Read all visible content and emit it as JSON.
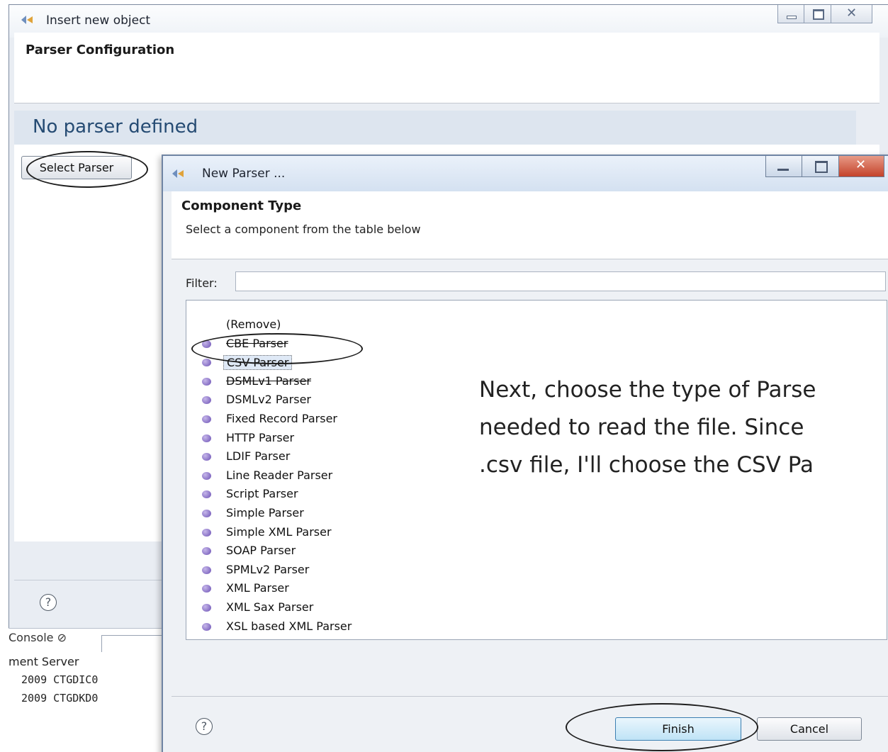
{
  "outer_window": {
    "title": "Insert new object",
    "header_title": "Parser Configuration",
    "status_message": "No parser defined",
    "select_parser_label": "Select Parser",
    "help_symbol": "?"
  },
  "console": {
    "tab_label": "Console ⊘",
    "server_line": "ment Server",
    "lines": [
      "2009 CTGDIC0",
      "2009 CTGDKD0"
    ]
  },
  "inner_dialog": {
    "title": "New Parser ...",
    "header_title": "Component Type",
    "header_subtitle": "Select a component from the table below",
    "filter_label": "Filter:",
    "filter_value": "",
    "items": [
      {
        "label": "(Remove)",
        "bullet": false,
        "selected": false,
        "struck": false
      },
      {
        "label": "CBE Parser",
        "bullet": true,
        "selected": false,
        "struck": true
      },
      {
        "label": "CSV Parser",
        "bullet": true,
        "selected": true,
        "struck": false
      },
      {
        "label": "DSMLv1 Parser",
        "bullet": true,
        "selected": false,
        "struck": true
      },
      {
        "label": "DSMLv2 Parser",
        "bullet": true,
        "selected": false,
        "struck": false
      },
      {
        "label": "Fixed Record Parser",
        "bullet": true,
        "selected": false,
        "struck": false
      },
      {
        "label": "HTTP Parser",
        "bullet": true,
        "selected": false,
        "struck": false
      },
      {
        "label": "LDIF Parser",
        "bullet": true,
        "selected": false,
        "struck": false
      },
      {
        "label": "Line Reader Parser",
        "bullet": true,
        "selected": false,
        "struck": false
      },
      {
        "label": "Script Parser",
        "bullet": true,
        "selected": false,
        "struck": false
      },
      {
        "label": "Simple Parser",
        "bullet": true,
        "selected": false,
        "struck": false
      },
      {
        "label": "Simple XML Parser",
        "bullet": true,
        "selected": false,
        "struck": false
      },
      {
        "label": "SOAP Parser",
        "bullet": true,
        "selected": false,
        "struck": false
      },
      {
        "label": "SPMLv2 Parser",
        "bullet": true,
        "selected": false,
        "struck": false
      },
      {
        "label": "XML Parser",
        "bullet": true,
        "selected": false,
        "struck": false
      },
      {
        "label": "XML Sax Parser",
        "bullet": true,
        "selected": false,
        "struck": false
      },
      {
        "label": "XSL based XML Parser",
        "bullet": true,
        "selected": false,
        "struck": false
      }
    ],
    "help_symbol": "?",
    "finish_label": "Finish",
    "cancel_label": "Cancel"
  },
  "annotation": {
    "lines": [
      "Next, choose the type of Parse",
      "needed to read the file. Since",
      ".csv file, I'll choose the CSV Pa"
    ]
  },
  "colors": {
    "status_blue": "#254b73",
    "bullet_purple": "#6a4fb4",
    "finish_accent": "#3c7fb1"
  }
}
